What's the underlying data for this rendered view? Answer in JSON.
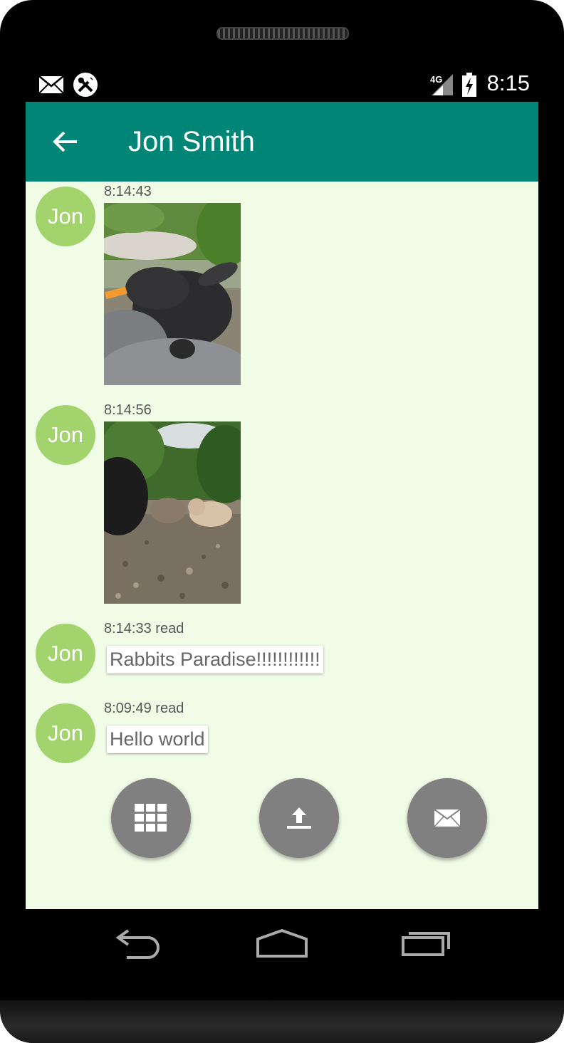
{
  "status_bar": {
    "time": "8:15",
    "network": "4G",
    "icons": [
      "mail-notification-icon",
      "tools-notification-icon",
      "signal-4g-icon",
      "battery-charging-icon"
    ]
  },
  "app_bar": {
    "title": "Jon Smith",
    "back_icon": "arrow-left-icon",
    "color": "#008577"
  },
  "messages": [
    {
      "sender": "Jon",
      "timestamp": "8:14:43",
      "type": "image",
      "image": "black rabbit eating a carrot"
    },
    {
      "sender": "Jon",
      "timestamp": "8:14:56",
      "type": "image",
      "image": "rabbits on gravel near trees"
    },
    {
      "sender": "Jon",
      "timestamp": "8:14:33 read",
      "type": "text",
      "text": "Rabbits Paradise!!!!!!!!!!!!"
    },
    {
      "sender": "Jon",
      "timestamp": "8:09:49 read",
      "type": "text",
      "text": "Hello world"
    }
  ],
  "actions": [
    {
      "name": "grid-apps-button",
      "icon": "grid-icon"
    },
    {
      "name": "upload-button",
      "icon": "upload-icon"
    },
    {
      "name": "send-mail-button",
      "icon": "mail-icon"
    }
  ],
  "nav": [
    "back-nav-icon",
    "home-nav-icon",
    "recents-nav-icon"
  ],
  "colors": {
    "background": "#f0fce6",
    "avatar": "#a2d36d",
    "fab": "#808080"
  }
}
